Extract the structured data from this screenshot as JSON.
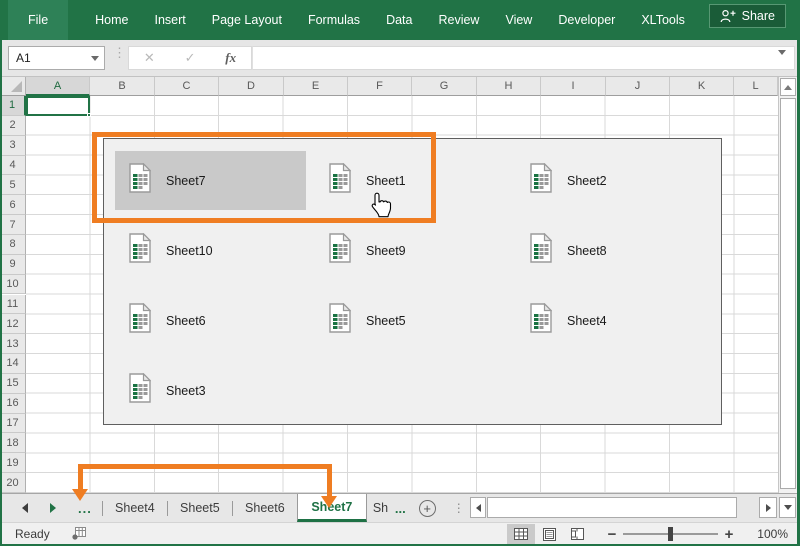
{
  "window": {
    "accent_color": "#217346",
    "annotation_color": "#ef7d22"
  },
  "ribbon": {
    "tabs": [
      {
        "label": "File",
        "active": true
      },
      {
        "label": "Home",
        "active": false
      },
      {
        "label": "Insert",
        "active": false
      },
      {
        "label": "Page Layout",
        "active": false
      },
      {
        "label": "Formulas",
        "active": false
      },
      {
        "label": "Data",
        "active": false
      },
      {
        "label": "Review",
        "active": false
      },
      {
        "label": "View",
        "active": false
      },
      {
        "label": "Developer",
        "active": false
      },
      {
        "label": "XLTools",
        "active": false
      }
    ],
    "share_label": "Share"
  },
  "formula_bar": {
    "name_box_value": "A1",
    "cancel_glyph": "✕",
    "enter_glyph": "✓",
    "fx_label": "fx",
    "input_value": ""
  },
  "grid": {
    "column_letters": [
      "A",
      "B",
      "C",
      "D",
      "E",
      "F",
      "G",
      "H",
      "I",
      "J",
      "K",
      "L"
    ],
    "row_count": 20,
    "active_cell": "A1",
    "selected_column": "A",
    "selected_row": "1"
  },
  "sheets_popup": {
    "items": [
      {
        "label": "Sheet7",
        "selected": true,
        "row": 0,
        "col": 0
      },
      {
        "label": "Sheet1",
        "selected": false,
        "row": 0,
        "col": 1
      },
      {
        "label": "Sheet2",
        "selected": false,
        "row": 0,
        "col": 2
      },
      {
        "label": "Sheet10",
        "selected": false,
        "row": 1,
        "col": 0
      },
      {
        "label": "Sheet9",
        "selected": false,
        "row": 1,
        "col": 1
      },
      {
        "label": "Sheet8",
        "selected": false,
        "row": 1,
        "col": 2
      },
      {
        "label": "Sheet6",
        "selected": false,
        "row": 2,
        "col": 0
      },
      {
        "label": "Sheet5",
        "selected": false,
        "row": 2,
        "col": 1
      },
      {
        "label": "Sheet4",
        "selected": false,
        "row": 2,
        "col": 2
      },
      {
        "label": "Sheet3",
        "selected": false,
        "row": 3,
        "col": 0
      }
    ]
  },
  "sheet_tab_bar": {
    "overflow_left_indicator": "...",
    "tabs": [
      {
        "label": "Sheet4",
        "active": false,
        "partial": false
      },
      {
        "label": "Sheet5",
        "active": false,
        "partial": false
      },
      {
        "label": "Sheet6",
        "active": false,
        "partial": false
      },
      {
        "label": "Sheet7",
        "active": true,
        "partial": false
      },
      {
        "label": "Sh",
        "active": false,
        "partial": true
      }
    ],
    "more_indicator": "...",
    "add_sheet_glyph": "+"
  },
  "status_bar": {
    "ready_label": "Ready",
    "zoom_level": "100%"
  }
}
